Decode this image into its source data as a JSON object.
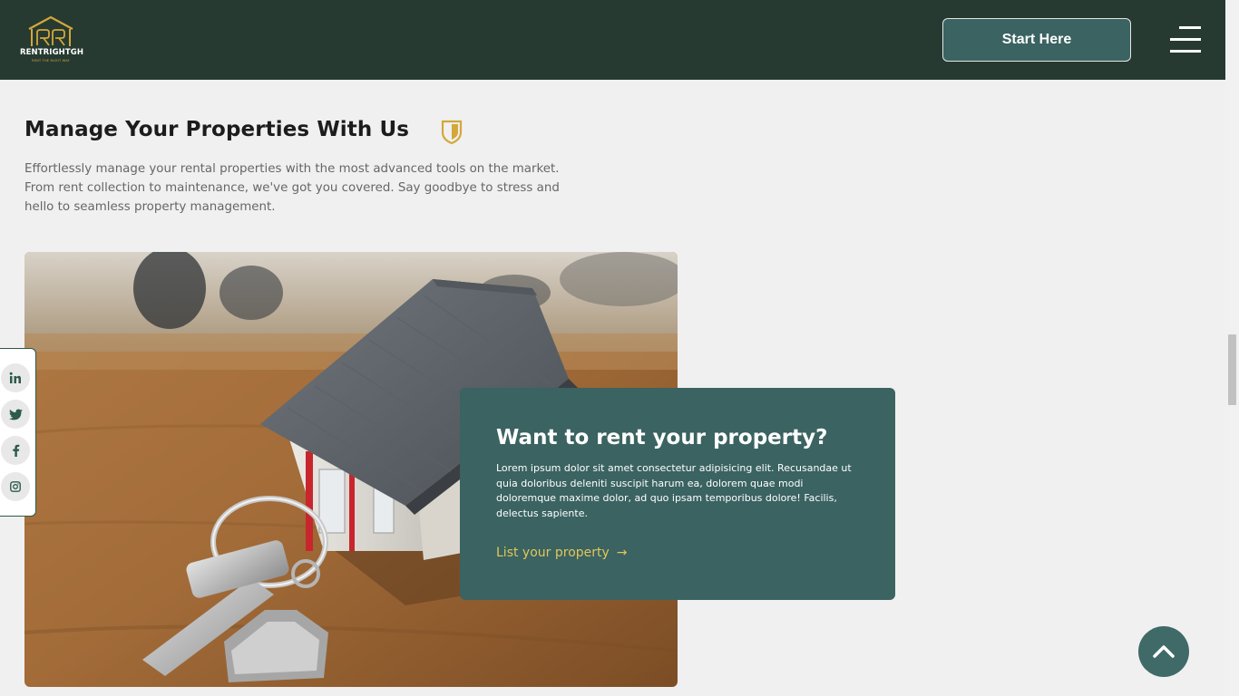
{
  "header": {
    "logo_text": "RENTRIGHTGH",
    "logo_tagline": "RENT THE RIGHT WAY",
    "start_button_label": "Start Here",
    "menu_icon": "hamburger-menu-icon"
  },
  "intro": {
    "title": "Manage Your Properties With Us",
    "description": "Effortlessly manage your rental properties with the most advanced tools on the market. From rent collection to maintenance, we've got you covered. Say goodbye to stress and hello to seamless property management.",
    "badge_icon": "shield-icon"
  },
  "card": {
    "title": "Want to rent your property?",
    "body": "Lorem ipsum dolor sit amet consectetur adipisicing elit. Recusandae ut quia doloribus deleniti suscipit harum ea, dolorem quae modi doloremque maxime dolor, ad quo ipsam temporibus dolore! Facilis, delectus sapiente.",
    "link_label": "List your property",
    "link_arrow": "→"
  },
  "social": {
    "items": [
      {
        "icon": "linkedin-icon"
      },
      {
        "icon": "twitter-icon"
      },
      {
        "icon": "facebook-icon"
      },
      {
        "icon": "instagram-icon"
      }
    ]
  },
  "colors": {
    "header_bg": "#263a31",
    "accent_teal": "#3a6361",
    "accent_gold": "#d4a73a",
    "link_yellow": "#e2c55c",
    "page_bg": "#f0f0f0"
  }
}
